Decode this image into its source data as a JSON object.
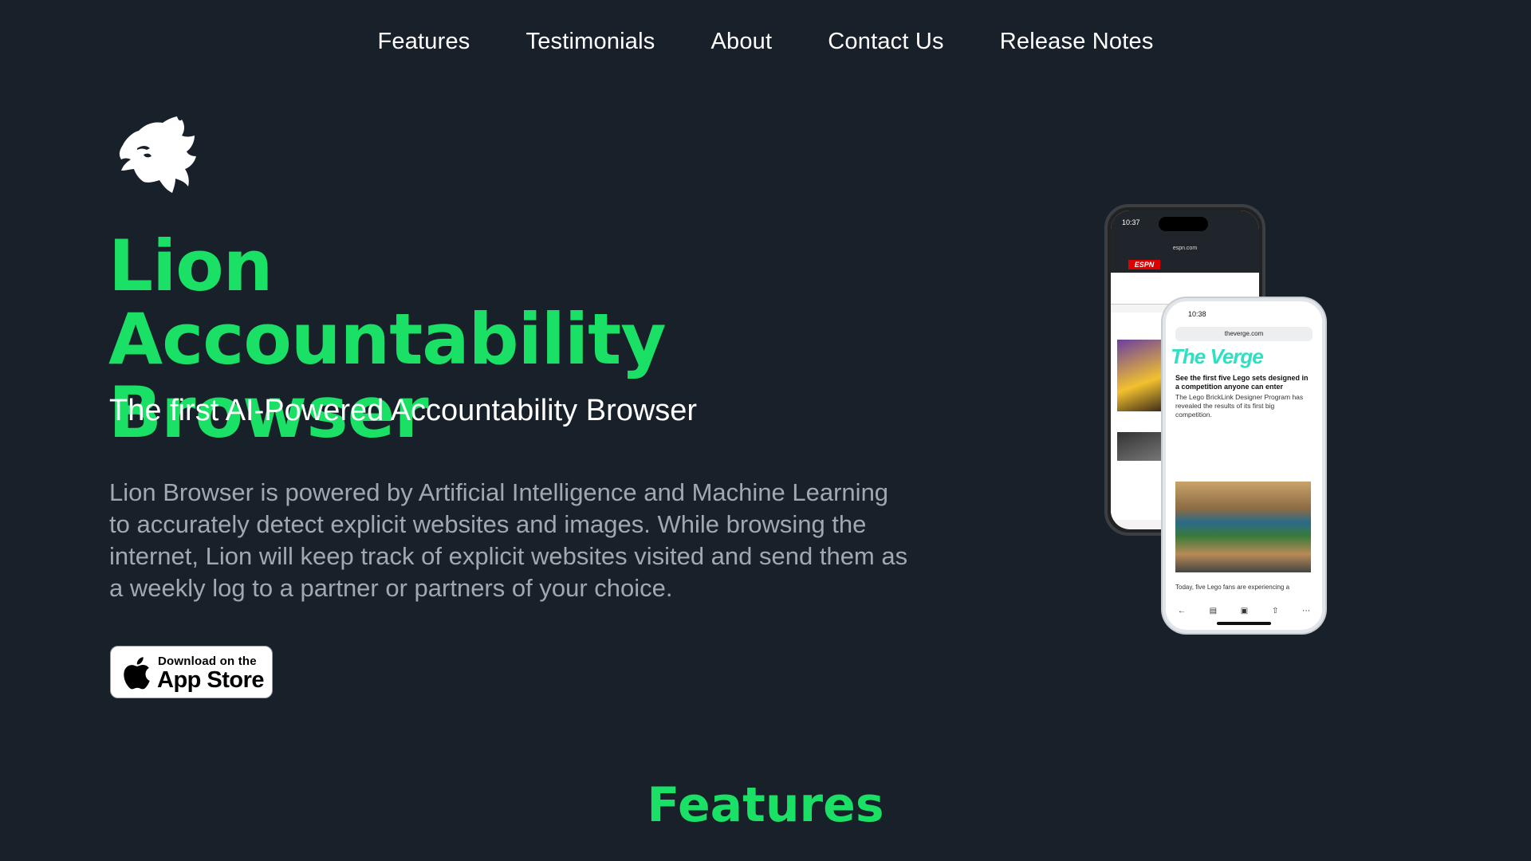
{
  "nav": {
    "items": [
      "Features",
      "Testimonials",
      "About",
      "Contact Us",
      "Release Notes"
    ]
  },
  "hero": {
    "logo_icon": "lion-head-icon",
    "title_line1": "Lion Accountability",
    "title_line2": "Browser",
    "subtitle": "The first AI-Powered Accountability Browser",
    "description": "Lion Browser is powered by Artificial Intelligence and Machine Learning to accurately detect explicit websites and images. While browsing the internet, Lion will keep track of explicit websites visited and send them as a weekly log to a partner or partners of your choice.",
    "appstore": {
      "small": "Download on the",
      "big": "App Store",
      "icon": "apple-icon"
    }
  },
  "phones": {
    "back": {
      "time": "10:37",
      "url": "espn.com",
      "brand": "ESPN"
    },
    "front": {
      "time": "10:38",
      "url": "theverge.com",
      "brand": "The Verge",
      "headline": "See the first five Lego sets designed in a competition anyone can enter",
      "body": "The Lego BrickLink Designer Program has revealed the results of its first big competition.",
      "caption": "Today, five Lego fans are experiencing a"
    }
  },
  "features_section": {
    "heading": "Features"
  },
  "colors": {
    "background": "#18202a",
    "accent": "#1ae065",
    "muted_text": "#a3a8ae"
  }
}
